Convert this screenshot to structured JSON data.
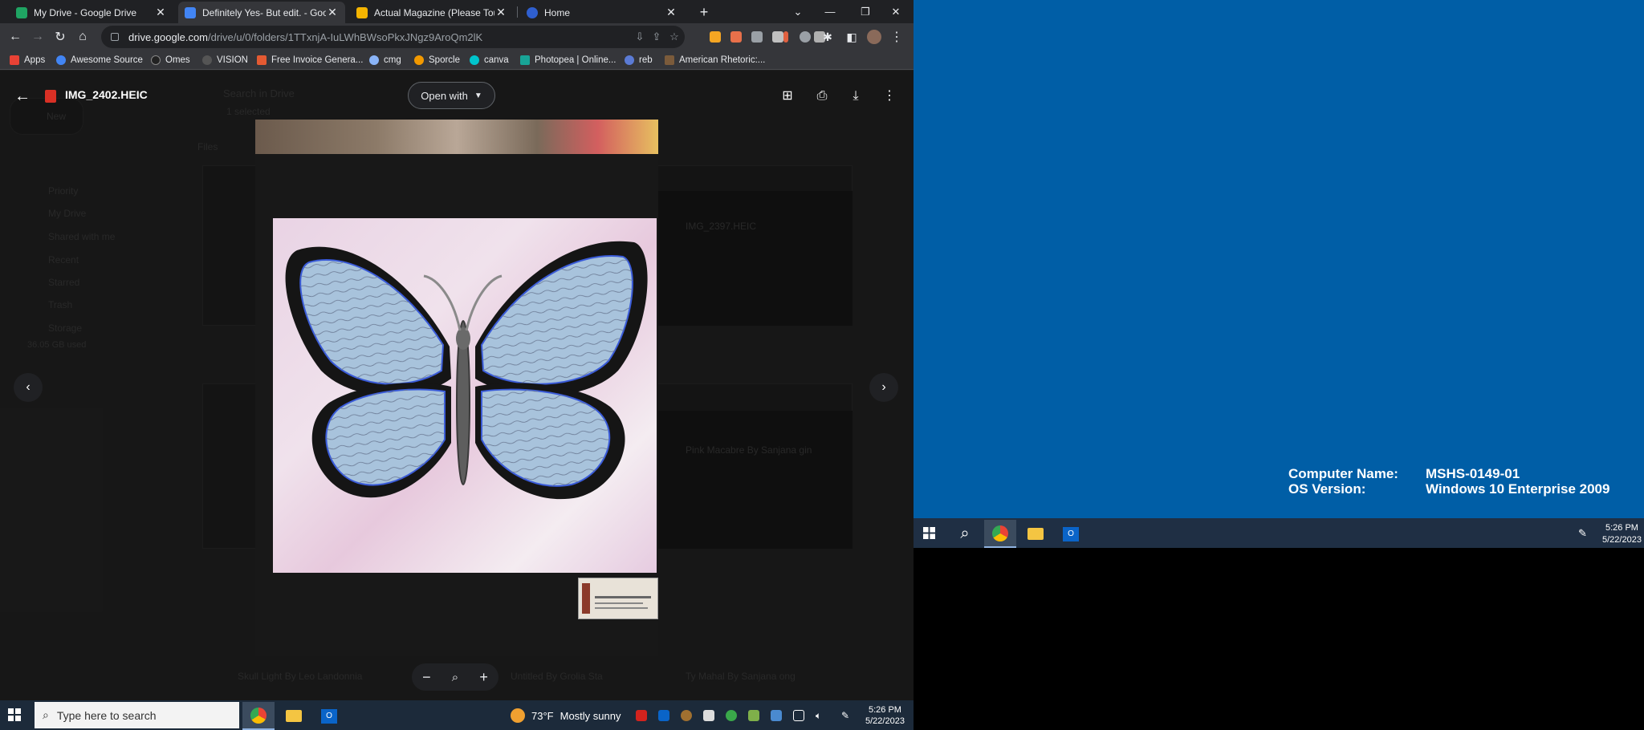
{
  "browser": {
    "tabs": [
      {
        "title": "My Drive - Google Drive",
        "active": false,
        "favicon_color": "#1fa463"
      },
      {
        "title": "Definitely Yes- But edit. - Google",
        "active": true,
        "favicon_color": "#4285f4"
      },
      {
        "title": "Actual Magazine (Please Touch)",
        "active": false,
        "favicon_color": "#f4b400"
      },
      {
        "title": "Home",
        "active": false,
        "favicon_color": "#2f5fcf"
      }
    ],
    "new_tab": "+",
    "url_host": "drive.google.com",
    "url_path": "/drive/u/0/folders/1TTxnjA-IuLWhBWsoPkxJNgz9AroQm2lK",
    "bookmarks": [
      {
        "label": "Apps",
        "color": "#e94235"
      },
      {
        "label": "Awesome Source",
        "color": "#4285f4"
      },
      {
        "label": "Omes",
        "color": "#222222"
      },
      {
        "label": "VISION",
        "color": "#555555"
      },
      {
        "label": "Free Invoice Genera...",
        "color": "#e45a32"
      },
      {
        "label": "cmg",
        "color": "#8ab4f8"
      },
      {
        "label": "Sporcle",
        "color": "#f29900"
      },
      {
        "label": "canva",
        "color": "#00c4cc"
      },
      {
        "label": "Photopea | Online...",
        "color": "#18a497"
      },
      {
        "label": "reb",
        "color": "#5b7bd5"
      },
      {
        "label": "American Rhetoric:...",
        "color": "#7b5b3b"
      }
    ]
  },
  "drive_background": {
    "search_placeholder": "Search in Drive",
    "new_button": "New",
    "nav": [
      "Priority",
      "My Drive",
      "Shared with me",
      "Recent",
      "Starred",
      "Trash",
      "Storage"
    ],
    "storage_text": "36.05 GB used",
    "selection_text": "1 selected",
    "section": "Files",
    "file_titles": [
      "IMG_2397.HEIC",
      "Pink Macabre By Sanjana gin",
      "Skull Light By Leo Landonnia",
      "Untitled By Grolia Sta",
      "Ty Mahal By Sanjana ong"
    ]
  },
  "viewer": {
    "file_name": "IMG_2402.HEIC",
    "open_with": "Open with",
    "actions": [
      "add-comment",
      "print",
      "download",
      "more"
    ],
    "image_alt": "Butterfly artwork with handwritten text"
  },
  "left_taskbar": {
    "search_placeholder": "Type here to search",
    "weather_temp": "73°F",
    "weather_text": "Mostly sunny",
    "time": "5:26 PM",
    "date": "5/22/2023"
  },
  "right_desktop": {
    "computer_name_label": "Computer Name:",
    "computer_name": "MSHS-0149-01",
    "os_label": "OS Version:",
    "os_version": "Windows 10 Enterprise 2009",
    "time": "5:26 PM",
    "date": "5/22/2023"
  }
}
